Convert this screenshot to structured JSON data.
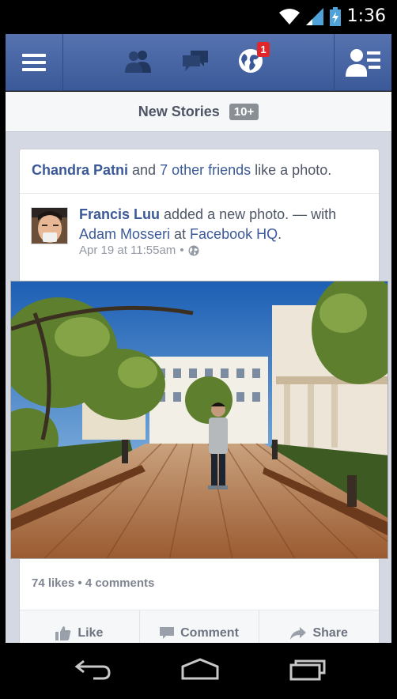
{
  "status_bar": {
    "time": "1:36",
    "icons": [
      "wifi-icon",
      "cell-signal-icon",
      "battery-charging-icon"
    ]
  },
  "navbar": {
    "icons": [
      "menu-icon",
      "friend-requests-icon",
      "messages-icon",
      "notifications-globe-icon",
      "profile-list-icon"
    ],
    "notifications_badge": "1",
    "accent_color": "#3b5998",
    "badge_color": "#e0262a"
  },
  "new_stories": {
    "label": "New Stories",
    "count": "10+"
  },
  "story": {
    "header": {
      "actor": "Chandra Patni",
      "middle": " and ",
      "others": "7 other friends",
      "action": " like a photo."
    },
    "author": "Francis Luu",
    "action_text": " added a new photo. — with ",
    "tagged": "Adam Mosseri",
    "at_text": " at ",
    "place": "Facebook HQ",
    "end": ".",
    "timestamp": "Apr 19 at 11:55am",
    "separator": "•",
    "privacy_icon": "public-globe-icon",
    "likes": "74 likes",
    "stats_separator": "•",
    "comments": "4 comments"
  },
  "actions": {
    "like": "Like",
    "comment": "Comment",
    "share": "Share"
  },
  "system_nav": [
    "back-icon",
    "home-icon",
    "recent-apps-icon"
  ]
}
